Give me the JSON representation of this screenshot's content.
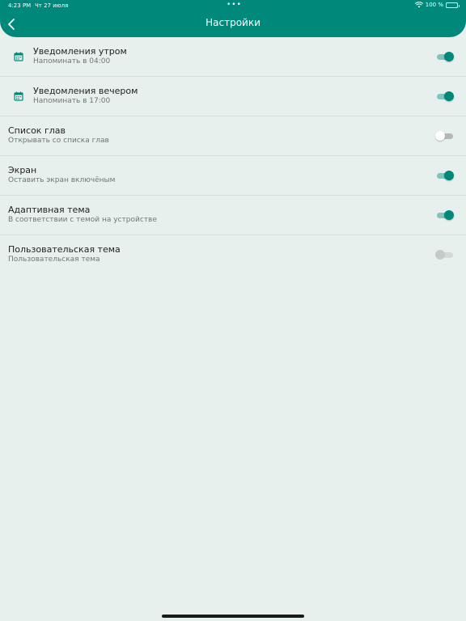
{
  "status": {
    "time": "4:23 PM",
    "date": "Чт 27 июля",
    "dots": "•••",
    "battery": "100 %"
  },
  "header": {
    "title": "Настройки"
  },
  "colors": {
    "accent": "#00897b",
    "background": "#e8f0ee"
  },
  "settings": [
    {
      "title": "Уведомления утром",
      "subtitle": "Напоминать в 04:00",
      "icon": "calendar-icon",
      "state": "on"
    },
    {
      "title": "Уведомления вечером",
      "subtitle": "Напоминать в 17:00",
      "icon": "calendar-icon",
      "state": "on"
    },
    {
      "title": "Список глав",
      "subtitle": "Открывать со списка глав",
      "state": "off"
    },
    {
      "title": "Экран",
      "subtitle": "Оставить экран включёным",
      "state": "on"
    },
    {
      "title": "Адаптивная тема",
      "subtitle": "В соответствии с темой на устройстве",
      "state": "on"
    },
    {
      "title": "Пользовательская тема",
      "subtitle": "Пользовательская тема",
      "state": "disabled"
    }
  ]
}
